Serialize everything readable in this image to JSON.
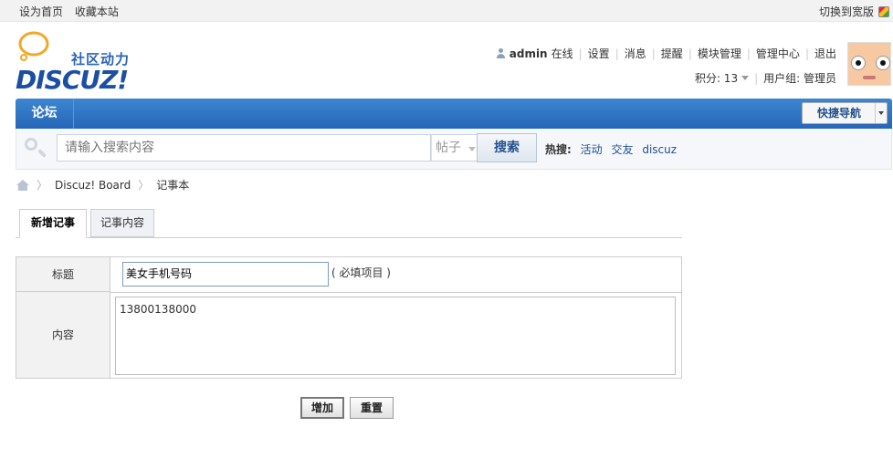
{
  "topbar": {
    "set_home": "设为首页",
    "bookmark": "收藏本站",
    "switch_wide": "切换到宽版"
  },
  "logo": {
    "slogan": "社区动力",
    "brand": "DISCUZ!"
  },
  "user": {
    "name": "admin",
    "status": "在线",
    "links": [
      "设置",
      "消息",
      "提醒",
      "模块管理",
      "管理中心",
      "退出"
    ],
    "points_label": "积分: 13",
    "group_label": "用户组: 管理员"
  },
  "nav": {
    "forum_tab": "论坛",
    "quick_nav": "快捷导航"
  },
  "search": {
    "placeholder": "请输入搜索内容",
    "type": "帖子",
    "button": "搜索",
    "hot_label": "热搜:",
    "hot_terms": [
      "活动",
      "交友",
      "discuz"
    ]
  },
  "breadcrumb": {
    "board": "Discuz! Board",
    "current": "记事本"
  },
  "tabs": {
    "add_note": "新增记事",
    "note_content": "记事内容"
  },
  "form": {
    "title_label": "标题",
    "title_value": "美女手机号码",
    "required_hint": "( 必填项目 )",
    "content_label": "内容",
    "content_value": "13800138000"
  },
  "actions": {
    "add": "增加",
    "reset": "重置"
  }
}
